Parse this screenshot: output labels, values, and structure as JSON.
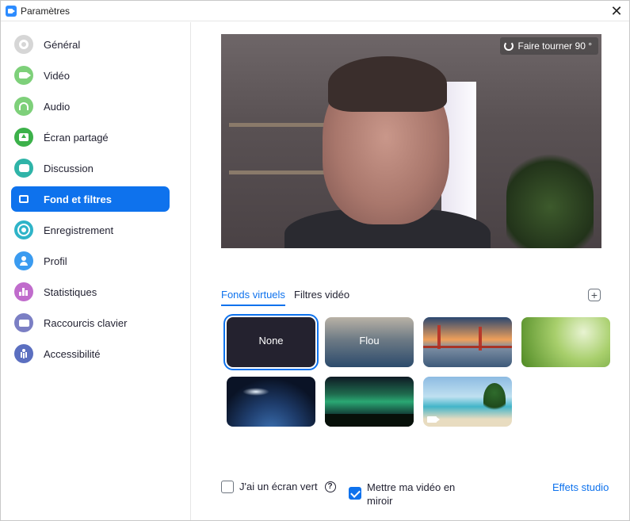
{
  "window": {
    "title": "Paramètres",
    "close_glyph": "✕"
  },
  "sidebar": {
    "items": [
      {
        "label": "Général",
        "icon": "gear-icon",
        "color": "#d6d6d6"
      },
      {
        "label": "Vidéo",
        "icon": "camera-icon",
        "color": "#7ed07a"
      },
      {
        "label": "Audio",
        "icon": "headphones-icon",
        "color": "#7ed07a"
      },
      {
        "label": "Écran partagé",
        "icon": "share-screen-icon",
        "color": "#3cb14a"
      },
      {
        "label": "Discussion",
        "icon": "chat-icon",
        "color": "#2fb4a8"
      },
      {
        "label": "Fond et filtres",
        "icon": "background-icon",
        "color": "#0e72ed",
        "active": true
      },
      {
        "label": "Enregistrement",
        "icon": "record-icon",
        "color": "#2fb4c8"
      },
      {
        "label": "Profil",
        "icon": "profile-icon",
        "color": "#3a9bf0"
      },
      {
        "label": "Statistiques",
        "icon": "stats-icon",
        "color": "#c06ccc"
      },
      {
        "label": "Raccourcis clavier",
        "icon": "keyboard-icon",
        "color": "#7b7fc4"
      },
      {
        "label": "Accessibilité",
        "icon": "accessibility-icon",
        "color": "#5b6fc0"
      }
    ]
  },
  "preview": {
    "rotate_label": "Faire tourner 90 °"
  },
  "tabs": [
    {
      "label": "Fonds virtuels",
      "active": true
    },
    {
      "label": "Filtres vidéo",
      "active": false
    }
  ],
  "add_glyph": "+",
  "backgrounds": [
    {
      "label": "None",
      "kind": "none",
      "selected": true
    },
    {
      "label": "Flou",
      "kind": "blur"
    },
    {
      "label": "",
      "kind": "bridge"
    },
    {
      "label": "",
      "kind": "grass"
    },
    {
      "label": "",
      "kind": "earth"
    },
    {
      "label": "",
      "kind": "aurora",
      "video": true
    },
    {
      "label": "",
      "kind": "beach",
      "video": true
    }
  ],
  "options": {
    "green_screen": {
      "label": "J'ai un écran vert",
      "checked": false,
      "help_glyph": "?"
    },
    "mirror": {
      "label_line1": "Mettre ma vidéo en",
      "label_line2": "miroir",
      "checked": true
    }
  },
  "studio_link": "Effets studio",
  "accent_color": "#0e72ed"
}
